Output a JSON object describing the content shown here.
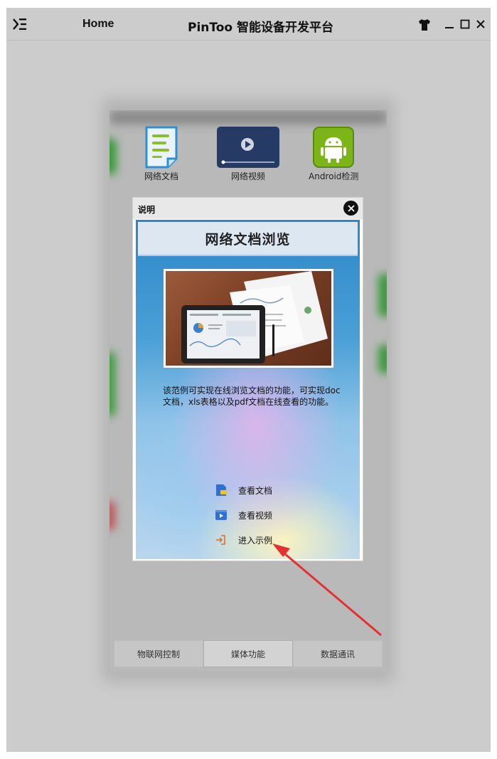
{
  "titlebar": {
    "home": "Home",
    "title": "PinToo 智能设备开发平台",
    "icons": [
      "menu-icon",
      "skin-icon",
      "minimize-icon",
      "maximize-icon",
      "close-icon"
    ]
  },
  "apps": [
    {
      "label": "网络文档",
      "icon": "document-icon"
    },
    {
      "label": "网络视频",
      "icon": "video-icon"
    },
    {
      "label": "Android检测",
      "icon": "android-icon"
    }
  ],
  "tabs": [
    {
      "label": "物联网控制",
      "active": false
    },
    {
      "label": "媒体功能",
      "active": true
    },
    {
      "label": "数据通讯",
      "active": false
    }
  ],
  "dialog": {
    "title": "说明",
    "banner": "网络文档浏览",
    "description": "该范例可实现在线浏览文档的功能，可实现doc文档，xls表格以及pdf文档在线查看的功能。",
    "links": [
      {
        "label": "查看文档",
        "icon": "document-link-icon"
      },
      {
        "label": "查看视频",
        "icon": "video-link-icon"
      },
      {
        "label": "进入示例",
        "icon": "enter-icon"
      }
    ]
  },
  "colors": {
    "accent_blue": "#2d86c8",
    "android_green": "#7cb518",
    "arrow_red": "#e53030"
  }
}
